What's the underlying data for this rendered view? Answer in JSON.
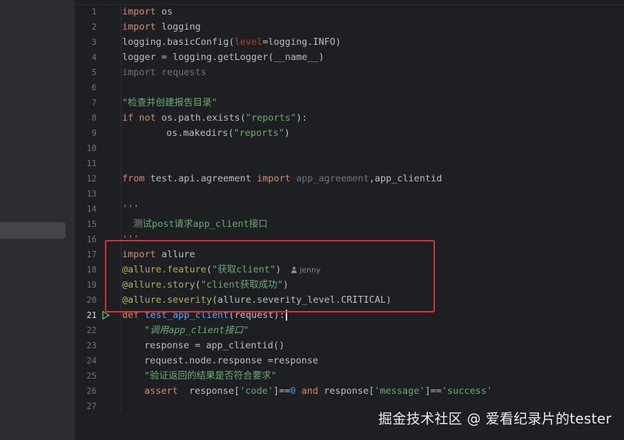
{
  "line_numbers": [
    "1",
    "2",
    "3",
    "4",
    "5",
    "6",
    "7",
    "8",
    "9",
    "10",
    "11",
    "12",
    "13",
    "14",
    "15",
    "16",
    "17",
    "18",
    "19",
    "20",
    "21",
    "22",
    "23",
    "24",
    "25",
    "26",
    "27"
  ],
  "current_line": "21",
  "code": {
    "l1": {
      "k": "import",
      "t": " os"
    },
    "l2": {
      "k": "import",
      "t": " logging"
    },
    "l3": {
      "a": "logging.basicConfig(",
      "p": "level",
      "b": "=logging.INFO)"
    },
    "l4": {
      "t": "logger = logging.getLogger(__name__)"
    },
    "l5": {
      "t": "import requests"
    },
    "l7": {
      "s": "\"检查并创建报告目录\""
    },
    "l8": {
      "k1": "if",
      "k2": "not",
      "t": " os.path.exists(",
      "s": "\"reports\"",
      "e": "):"
    },
    "l9": {
      "t": "os.makedirs(",
      "s": "\"reports\"",
      "e": ")"
    },
    "l12": {
      "k1": "from",
      "t1": " test.api.agreement ",
      "k2": "import",
      "d": " app_agreement",
      "t2": ",app_clientid"
    },
    "l14": {
      "s": "'''"
    },
    "l15": {
      "s": "测试post请求app_client接口"
    },
    "l16": {
      "s": "'''"
    },
    "l17": {
      "k": "import",
      "t": " allure"
    },
    "l18": {
      "d": "@allure.feature",
      "a": "(",
      "s": "\"获取client\"",
      "e": ")",
      "hint": "jenny"
    },
    "l19": {
      "d": "@allure.story",
      "a": "(",
      "s": "\"client获取成功\"",
      "e": ")"
    },
    "l20": {
      "d": "@allure.severity",
      "t": "(allure.severity_level.CRITICAL)"
    },
    "l21": {
      "k": "def",
      "f": " test_app_client",
      "t": "(request):"
    },
    "l22": {
      "s": "\"调用app_client接口\""
    },
    "l23": {
      "t": "response = app_clientid()"
    },
    "l24": {
      "t": "request.node.response =response"
    },
    "l25": {
      "s": "\"验证返回的结果是否符合要求\""
    },
    "l26": {
      "k": "assert",
      "t1": "  response[",
      "s1": "'code'",
      "t2": "]==",
      "n": "0",
      "k2": " and",
      "t3": " response[",
      "s2": "'message'",
      "t4": "]==",
      "s3": "'success'"
    }
  },
  "watermark": "掘金技术社区 @ 爱看纪录片的tester",
  "colors": {
    "background": "#1e1f22",
    "keyword": "#cf8e6d",
    "string": "#6aab73",
    "decorator": "#b3ae60",
    "highlight_box": "#e03131"
  }
}
